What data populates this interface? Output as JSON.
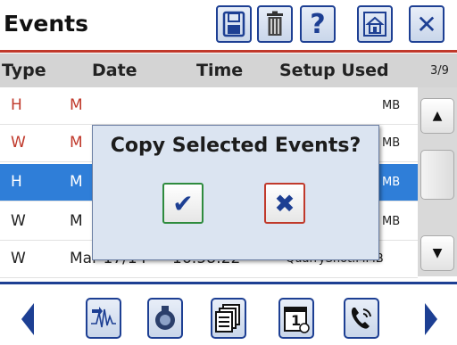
{
  "header": {
    "title": "Events",
    "buttons": [
      {
        "name": "save-icon"
      },
      {
        "name": "trash-icon"
      },
      {
        "name": "help-icon",
        "glyph": "?"
      },
      {
        "name": "home-icon"
      },
      {
        "name": "close-icon",
        "glyph": "✕"
      }
    ]
  },
  "columns": {
    "type": "Type",
    "date": "Date",
    "time": "Time",
    "setup": "Setup Used",
    "page": "3/9"
  },
  "rows": [
    {
      "type": "H",
      "date": "M",
      "time": "",
      "setup": "MB",
      "color": "#c0392b"
    },
    {
      "type": "W",
      "date": "M",
      "time": "",
      "setup": "MB",
      "color": "#c0392b"
    },
    {
      "type": "H",
      "date": "M",
      "time": "",
      "setup": "MB",
      "selected": true
    },
    {
      "type": "W",
      "date": "M",
      "time": "",
      "setup": "MB",
      "color": "#222222"
    },
    {
      "type": "W",
      "date": "Mar 17/14",
      "time": "16:58:22",
      "setup": "QuarryShot.MMB",
      "color": "#222222"
    }
  ],
  "scrollbar": {
    "up": "▲",
    "down": "▼"
  },
  "dialog": {
    "title": "Copy Selected Events?",
    "ok_glyph": "✔",
    "cancel_glyph": "✖"
  },
  "footer": {
    "buttons": [
      {
        "name": "waveform-import-icon"
      },
      {
        "name": "seal-icon"
      },
      {
        "name": "copy-pages-icon"
      },
      {
        "name": "calendar-one-icon",
        "glyph": "1"
      },
      {
        "name": "phone-icon"
      }
    ]
  },
  "colors": {
    "accent_red": "#c0392b",
    "accent_blue": "#1d3f93",
    "selection": "#2f7ed8",
    "ok_green": "#2e8b3e"
  }
}
